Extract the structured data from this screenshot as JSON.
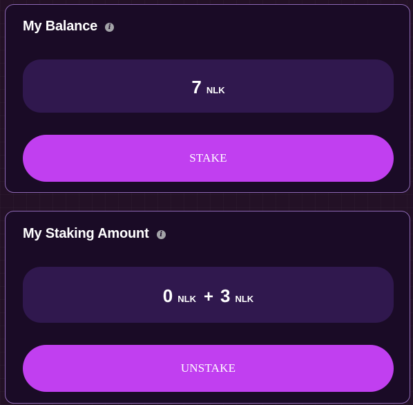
{
  "balance_card": {
    "title": "My Balance",
    "info_icon_glyph": "i",
    "amount": "7",
    "unit": "NLK",
    "button_label": "STAKE"
  },
  "staking_card": {
    "title": "My Staking Amount",
    "info_icon_glyph": "i",
    "staked_amount": "0",
    "staked_unit": "NLK",
    "operator": "+",
    "reward_amount": "3",
    "reward_unit": "NLK",
    "button_label": "UNSTAKE"
  },
  "colors": {
    "page_background": "#231126",
    "card_background": "#1a0b26",
    "card_border": "#8c68b4",
    "value_box_background": "#30184e",
    "button_background": "#c13ff0",
    "info_icon": "#a3a3a8"
  }
}
